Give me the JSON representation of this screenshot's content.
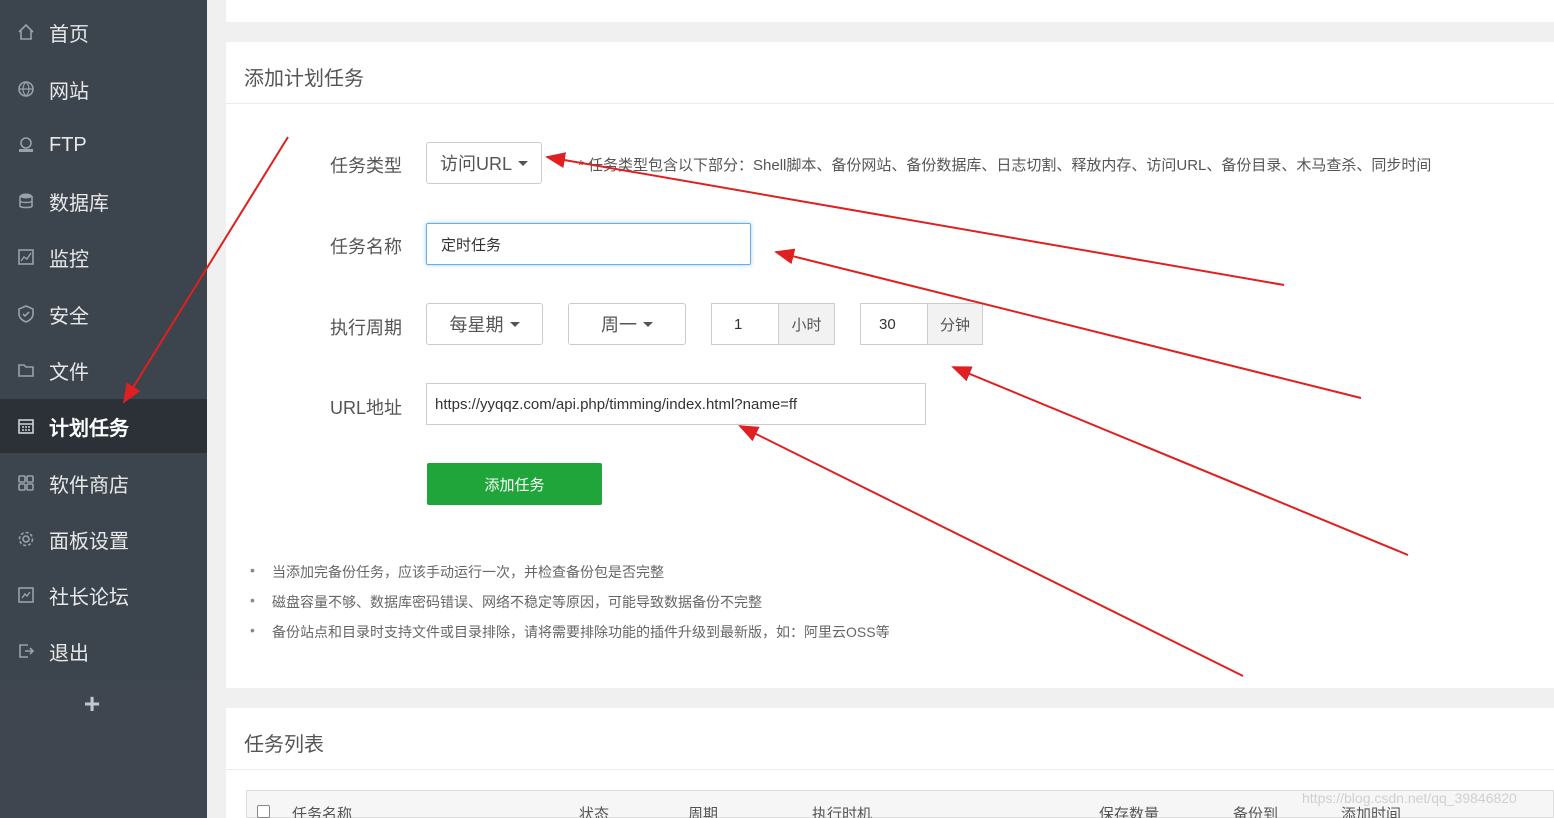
{
  "sidebar": {
    "items": [
      {
        "label": "首页",
        "icon": "home-icon"
      },
      {
        "label": "网站",
        "icon": "globe-icon"
      },
      {
        "label": "FTP",
        "icon": "ftp-icon"
      },
      {
        "label": "数据库",
        "icon": "database-icon"
      },
      {
        "label": "监控",
        "icon": "monitor-icon"
      },
      {
        "label": "安全",
        "icon": "shield-icon"
      },
      {
        "label": "文件",
        "icon": "folder-icon"
      },
      {
        "label": "计划任务",
        "icon": "calendar-icon"
      },
      {
        "label": "软件商店",
        "icon": "apps-icon"
      },
      {
        "label": "面板设置",
        "icon": "gear-icon"
      },
      {
        "label": "社长论坛",
        "icon": "forum-icon"
      },
      {
        "label": "退出",
        "icon": "logout-icon"
      }
    ],
    "active_label": "计划任务",
    "add_label": "+"
  },
  "form": {
    "title": "添加计划任务",
    "task_type_label": "任务类型",
    "task_type_value": "访问URL",
    "task_type_hint": "*  任务类型包含以下部分：Shell脚本、备份网站、备份数据库、日志切割、释放内存、访问URL、备份目录、木马查杀、同步时间",
    "task_name_label": "任务名称",
    "task_name_value": "定时任务",
    "period_label": "执行周期",
    "period_value": "每星期",
    "weekday_value": "周一",
    "hour_value": "1",
    "hour_unit": "小时",
    "minute_value": "30",
    "minute_unit": "分钟",
    "url_label": "URL地址",
    "url_value": "https://yyqqz.com/api.php/timming/index.html?name=ff",
    "submit_label": "添加任务"
  },
  "notes": [
    "当添加完备份任务，应该手动运行一次，并检查备份包是否完整",
    "磁盘容量不够、数据库密码错误、网络不稳定等原因，可能导致数据备份不完整",
    "备份站点和目录时支持文件或目录排除，请将需要排除功能的插件升级到最新版，如：阿里云OSS等"
  ],
  "task_list": {
    "title": "任务列表",
    "columns": [
      "任务名称",
      "状态",
      "周期",
      "执行时机",
      "保存数量",
      "备份到",
      "添加时间"
    ]
  },
  "watermark": "https://blog.csdn.net/qq_39846820",
  "colors": {
    "sidebar_bg": "#3c444d",
    "sidebar_active_bg": "#2c3138",
    "accent_green": "#20a53a",
    "annotation_red": "#e02020"
  }
}
